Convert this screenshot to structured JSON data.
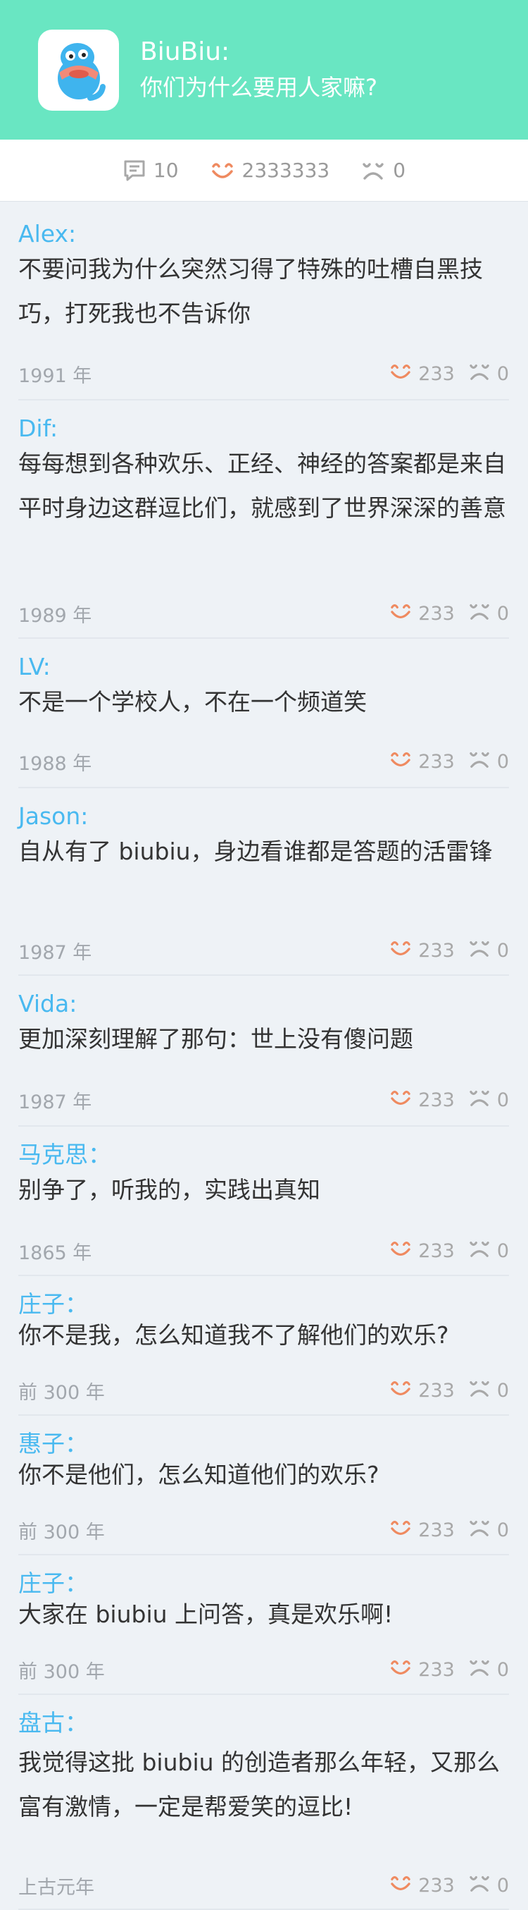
{
  "header": {
    "title": "BiuBiu:",
    "question": "你们为什么要用人家嘛?"
  },
  "stats": {
    "comments": "10",
    "likes": "2333333",
    "dislikes": "0"
  },
  "colors": {
    "header_bg": "#69e6c2",
    "name": "#49b9f0",
    "like_icon": "#ef8a60",
    "neutral_icon": "#a8a8a8"
  },
  "comments": [
    {
      "name": "Alex:",
      "text": "不要问我为什么突然习得了特殊的吐槽自黑技巧，打死我也不告诉你",
      "year": "1991 年",
      "likes": "233",
      "dislikes": "0"
    },
    {
      "name": "Dif:",
      "text": "每每想到各种欢乐、正经、神经的答案都是来自平时身边这群逗比们，就感到了世界深深的善意",
      "year": "1989 年",
      "likes": "233",
      "dislikes": "0"
    },
    {
      "name": "LV:",
      "text": "不是一个学校人，不在一个频道笑",
      "year": "1988 年",
      "likes": "233",
      "dislikes": "0"
    },
    {
      "name": "Jason:",
      "text": "自从有了 biubiu，身边看谁都是答题的活雷锋",
      "year": "1987 年",
      "likes": "233",
      "dislikes": "0"
    },
    {
      "name": "Vida:",
      "text": "更加深刻理解了那句：世上没有傻问题",
      "year": "1987 年",
      "likes": "233",
      "dislikes": "0"
    },
    {
      "name": "马克思：",
      "text": "别争了，听我的，实践出真知",
      "year": "1865 年",
      "likes": "233",
      "dislikes": "0"
    },
    {
      "name": "庄子：",
      "text": "你不是我，怎么知道我不了解他们的欢乐?",
      "year": "前 300 年",
      "likes": "233",
      "dislikes": "0"
    },
    {
      "name": "惠子：",
      "text": "你不是他们，怎么知道他们的欢乐?",
      "year": "前 300 年",
      "likes": "233",
      "dislikes": "0"
    },
    {
      "name": "庄子：",
      "text": "大家在 biubiu 上问答，真是欢乐啊!",
      "year": "前 300 年",
      "likes": "233",
      "dislikes": "0"
    },
    {
      "name": "盘古：",
      "text": "我觉得这批 biubiu 的创造者那么年轻，又那么富有激情，一定是帮爱笑的逗比!",
      "year": "上古元年",
      "likes": "233",
      "dislikes": "0"
    }
  ]
}
